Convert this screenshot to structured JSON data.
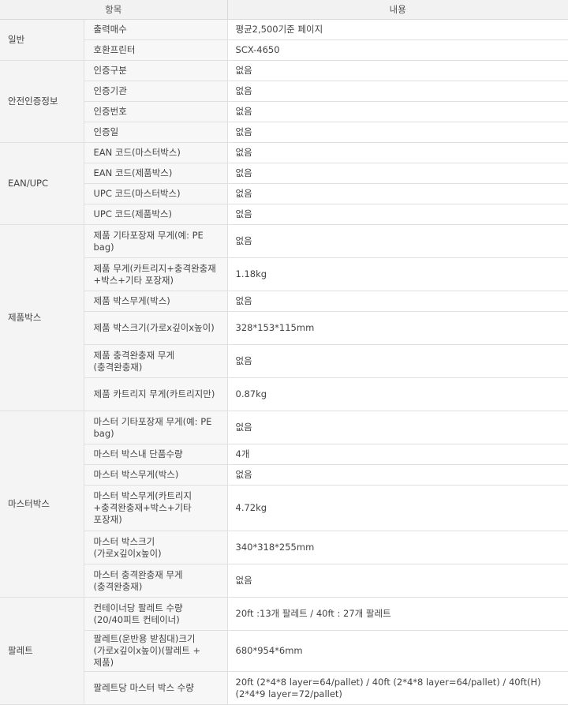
{
  "header": {
    "col_item": "항목",
    "col_content": "내용"
  },
  "groups": [
    {
      "category": "일반",
      "rows": [
        {
          "item": "출력매수",
          "value": "평균2,500기준 페이지",
          "h": 26
        },
        {
          "item": "호환프린터",
          "value": "SCX-4650",
          "h": 26
        }
      ]
    },
    {
      "category": "안전인증정보",
      "rows": [
        {
          "item": "인증구분",
          "value": "없음",
          "h": 26
        },
        {
          "item": "인증기관",
          "value": "없음",
          "h": 26
        },
        {
          "item": "인증번호",
          "value": "없음",
          "h": 26
        },
        {
          "item": "인증일",
          "value": "없음",
          "h": 26
        }
      ]
    },
    {
      "category": "EAN/UPC",
      "rows": [
        {
          "item": "EAN 코드(마스터박스)",
          "value": "없음",
          "h": 26
        },
        {
          "item": "EAN 코드(제품박스)",
          "value": "없음",
          "h": 26
        },
        {
          "item": "UPC 코드(마스터박스)",
          "value": "없음",
          "h": 26
        },
        {
          "item": "UPC 코드(제품박스)",
          "value": "없음",
          "h": 26
        }
      ]
    },
    {
      "category": "제품박스",
      "rows": [
        {
          "item": "제품 기타포장재 무게(예: PE bag)",
          "value": "없음",
          "h": 42
        },
        {
          "item": "제품 무게(카트리지+충격완충재+박스+기타 포장재)",
          "value": "1.18kg",
          "h": 42
        },
        {
          "item": "제품 박스무게(박스)",
          "value": "없음",
          "h": 26
        },
        {
          "item": "제품 박스크기(가로x깊이x높이)",
          "value": "328*153*115mm",
          "h": 42
        },
        {
          "item": "제품 충격완충재 무게(충격완충재)",
          "value": "없음",
          "h": 42
        },
        {
          "item": "제품 카트리지 무게(카트리지만)",
          "value": "0.87kg",
          "h": 42
        }
      ]
    },
    {
      "category": "마스터박스",
      "rows": [
        {
          "item": "마스터 기타포장재 무게(예: PE bag)",
          "value": "없음",
          "h": 42
        },
        {
          "item": "마스터 박스내 단품수량",
          "value": "4개",
          "h": 26
        },
        {
          "item": "마스터 박스무게(박스)",
          "value": "없음",
          "h": 26
        },
        {
          "item": "마스터 박스무게(카트리지+충격완충재+박스+기타 포장재)",
          "value": "4.72kg",
          "h": 58
        },
        {
          "item": "마스터 박스크기(가로x깊이x높이)",
          "value": "340*318*255mm",
          "h": 42
        },
        {
          "item": "마스터 충격완충재 무게(충격완충재)",
          "value": "없음",
          "h": 42
        }
      ]
    },
    {
      "category": "팔레트",
      "rows": [
        {
          "item": "컨테이너당 팔레트 수량(20/40피트 컨테이너)",
          "value": "20ft :13개 팔레트 / 40ft : 27개 팔레트",
          "h": 42
        },
        {
          "item": "팔레트(운반용 받침대)크기(가로x깊이x높이)(팔레트 + 제품)",
          "value": "680*954*6mm",
          "h": 42
        },
        {
          "item": "팔레트당 마스터 박스 수량",
          "value": "20ft (2*4*8 layer=64/pallet) / 40ft (2*4*8 layer=64/pallet) / 40ft(H) (2*4*9 layer=72/pallet)",
          "h": 42
        }
      ]
    }
  ]
}
